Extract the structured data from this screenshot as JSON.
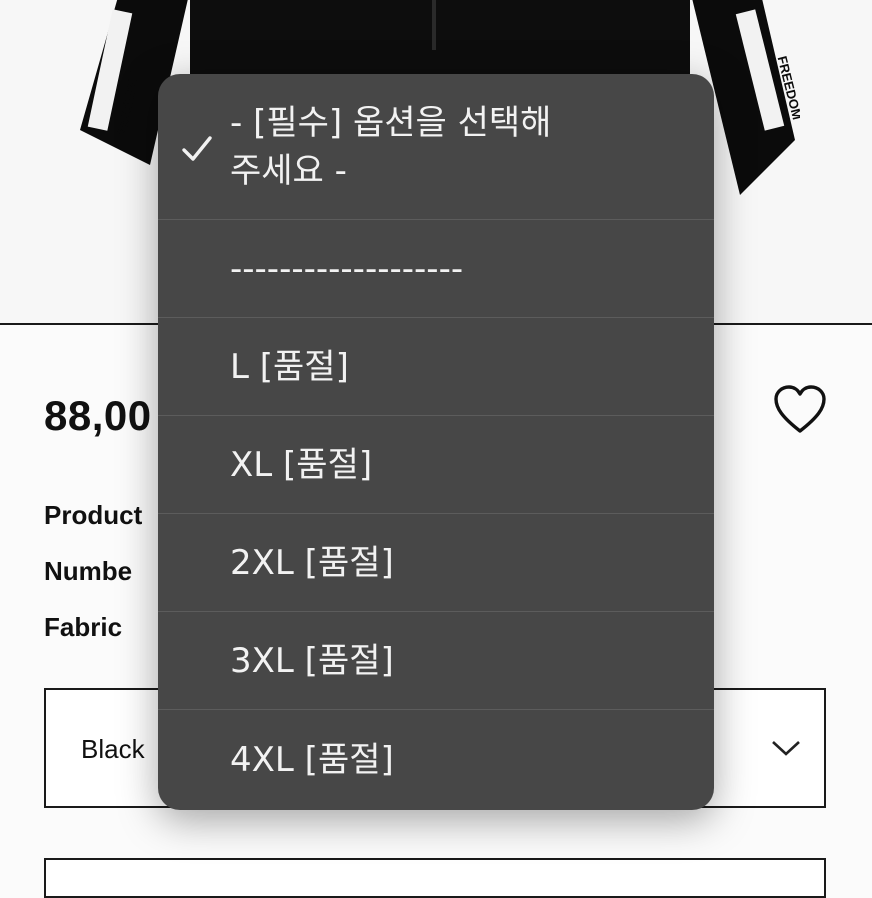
{
  "product": {
    "sleeve_text": "FREEDOM",
    "price": "88,00",
    "spec_labels": [
      "Product",
      "Numbe",
      "Fabric"
    ]
  },
  "color_select": {
    "value": "Black"
  },
  "option_menu": {
    "items": [
      {
        "label": "- [필수] 옵션을 선택해 주세요 -",
        "selected": true
      },
      {
        "label": "-------------------",
        "selected": false
      },
      {
        "label": "L [품절]",
        "selected": false
      },
      {
        "label": "XL [품절]",
        "selected": false
      },
      {
        "label": "2XL [품절]",
        "selected": false
      },
      {
        "label": "3XL [품절]",
        "selected": false
      },
      {
        "label": "4XL [품절]",
        "selected": false
      }
    ]
  },
  "colors": {
    "menu_bg": "#474747",
    "menu_text": "#f2f2f2",
    "divider": "#1a1a1a"
  },
  "icons": [
    "heart-icon",
    "chevron-down-icon",
    "checkmark-icon"
  ]
}
